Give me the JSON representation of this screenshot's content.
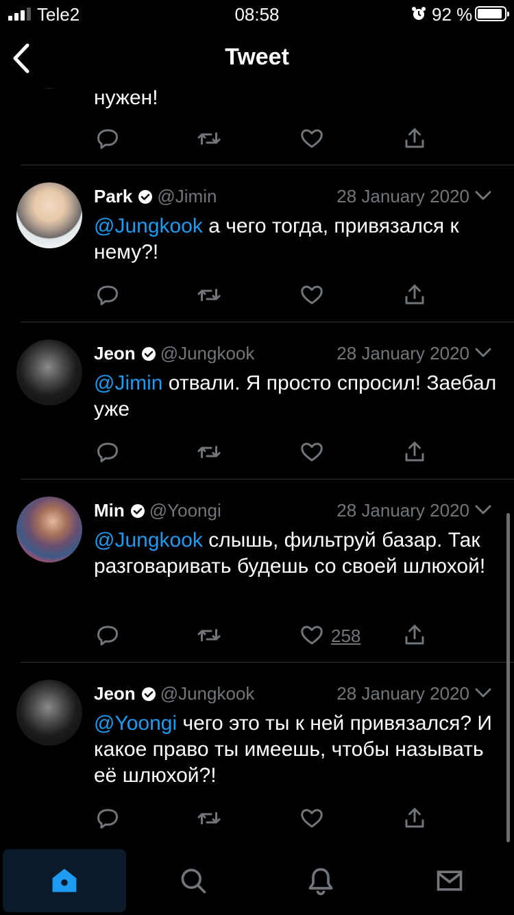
{
  "status_bar": {
    "carrier": "Tele2",
    "time": "08:58",
    "battery_percent": "92 %",
    "battery_level": 0.92,
    "signal_bars": 3
  },
  "nav": {
    "title": "Tweet"
  },
  "partial_tweet": {
    "text": "нужен!"
  },
  "tweets": [
    {
      "name": "Park",
      "handle": "@Jimin",
      "date": "28 January 2020",
      "mention": "@Jungkook",
      "text": " а чего тогда, привязался к нему?!",
      "likes": ""
    },
    {
      "name": "Jeon",
      "handle": "@Jungkook",
      "date": "28 January 2020",
      "mention": "@Jimin",
      "text": " отвали. Я просто спросил! Заебал уже",
      "likes": ""
    },
    {
      "name": "Min",
      "handle": "@Yoongi",
      "date": "28 January 2020",
      "mention": "@Jungkook",
      "text": " слышь, фильтруй базар. Так разговаривать будешь со своей шлюхой!",
      "likes": "258"
    },
    {
      "name": "Jeon",
      "handle": "@Jungkook",
      "date": "28 January 2020",
      "mention": "@Yoongi",
      "text": " чего это ты к ней привязался? И какое право ты имеешь, чтобы называть её шлюхой?!",
      "likes": ""
    }
  ],
  "colors": {
    "background": "#000000",
    "link": "#1d9bf0",
    "secondary_text": "#71767b",
    "divider": "#2f3336",
    "active_tab": "#1d9bf0"
  },
  "tab_bar": {
    "items": [
      {
        "icon": "home-icon",
        "active": true
      },
      {
        "icon": "search-icon",
        "active": false
      },
      {
        "icon": "bell-icon",
        "active": false
      },
      {
        "icon": "mail-icon",
        "active": false
      }
    ]
  }
}
